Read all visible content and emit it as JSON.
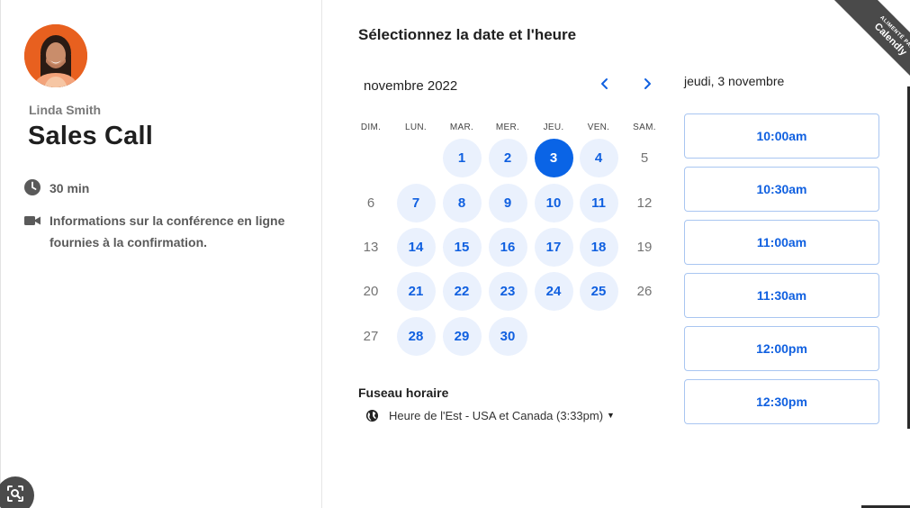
{
  "host": {
    "name": "Linda Smith"
  },
  "event": {
    "title": "Sales Call",
    "duration": "30 min",
    "conference_info": "Informations sur la conférence en ligne fournies à la confirmation."
  },
  "scheduler": {
    "heading": "Sélectionnez la date et l'heure",
    "month_label": "novembre 2022",
    "weekdays": [
      "DIM.",
      "LUN.",
      "MAR.",
      "MER.",
      "JEU.",
      "VEN.",
      "SAM."
    ],
    "days": [
      {
        "label": "1",
        "state": "available"
      },
      {
        "label": "2",
        "state": "available"
      },
      {
        "label": "3",
        "state": "selected"
      },
      {
        "label": "4",
        "state": "available"
      },
      {
        "label": "5",
        "state": "unavailable"
      },
      {
        "label": "6",
        "state": "unavailable"
      },
      {
        "label": "7",
        "state": "available"
      },
      {
        "label": "8",
        "state": "available"
      },
      {
        "label": "9",
        "state": "available"
      },
      {
        "label": "10",
        "state": "available"
      },
      {
        "label": "11",
        "state": "available"
      },
      {
        "label": "12",
        "state": "unavailable"
      },
      {
        "label": "13",
        "state": "unavailable"
      },
      {
        "label": "14",
        "state": "available"
      },
      {
        "label": "15",
        "state": "available"
      },
      {
        "label": "16",
        "state": "available"
      },
      {
        "label": "17",
        "state": "available"
      },
      {
        "label": "18",
        "state": "available"
      },
      {
        "label": "19",
        "state": "unavailable"
      },
      {
        "label": "20",
        "state": "unavailable"
      },
      {
        "label": "21",
        "state": "available"
      },
      {
        "label": "22",
        "state": "available"
      },
      {
        "label": "23",
        "state": "available"
      },
      {
        "label": "24",
        "state": "available"
      },
      {
        "label": "25",
        "state": "available"
      },
      {
        "label": "26",
        "state": "unavailable"
      },
      {
        "label": "27",
        "state": "unavailable"
      },
      {
        "label": "28",
        "state": "available"
      },
      {
        "label": "29",
        "state": "available"
      },
      {
        "label": "30",
        "state": "available"
      }
    ],
    "timezone_label": "Fuseau horaire",
    "timezone_value": "Heure de l'Est - USA et Canada (3:33pm)",
    "selected_date": "jeudi, 3 novembre",
    "time_slots": [
      "10:00am",
      "10:30am",
      "11:00am",
      "11:30am",
      "12:00pm",
      "12:30pm"
    ]
  },
  "badge": {
    "small_text": "ALIMENTÉ PAR",
    "brand": "Calendly"
  },
  "colors": {
    "accent": "#0a64e6",
    "available_bg": "#eaf1fd",
    "avatar_bg": "#e8601f",
    "ribbon": "#4a4a4a"
  },
  "icons": {
    "duration": "clock-icon",
    "conference": "video-camera-icon",
    "timezone": "globe-icon",
    "prev": "chevron-left-icon",
    "next": "chevron-right-icon",
    "lens": "lens-icon"
  }
}
